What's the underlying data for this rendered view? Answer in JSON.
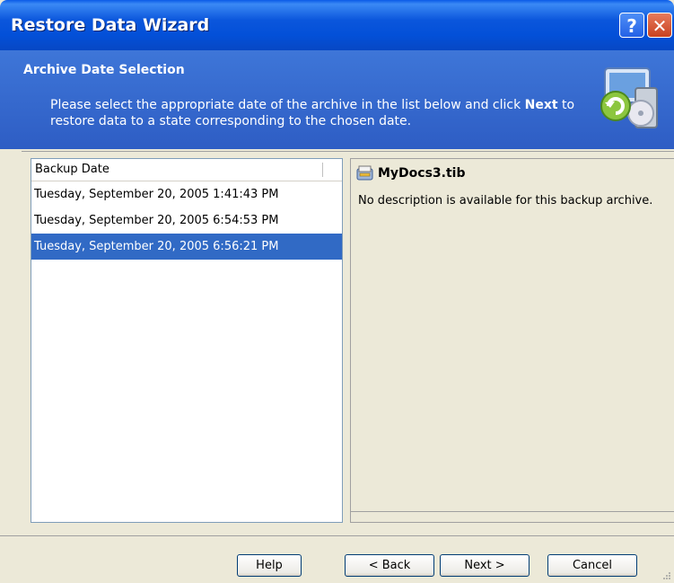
{
  "window": {
    "title": "Restore Data Wizard",
    "help_label": "?",
    "close_label": "✕"
  },
  "header": {
    "title": "Archive Date Selection",
    "desc_before": "Please select the appropriate date of the archive in the list below and click ",
    "desc_bold": "Next",
    "desc_after": " to restore data to a state corresponding to the chosen date.",
    "icon": "restore-computer-icon"
  },
  "list": {
    "column_header": "Backup Date",
    "rows": [
      "Tuesday, September 20, 2005 1:41:43 PM",
      "Tuesday, September 20, 2005 6:54:53 PM",
      "Tuesday, September 20, 2005 6:56:21 PM"
    ],
    "selected_index": 2
  },
  "info": {
    "file_icon": "archive-file-icon",
    "file_name": "MyDocs3.tib",
    "description": "No description is available for this backup archive."
  },
  "buttons": {
    "help": "Help",
    "back": "< Back",
    "next": "Next >",
    "cancel": "Cancel"
  },
  "colors": {
    "title_bar": "#0350d8",
    "header": "#2e5dc4",
    "selection": "#316ac5",
    "face": "#ece9d8"
  }
}
